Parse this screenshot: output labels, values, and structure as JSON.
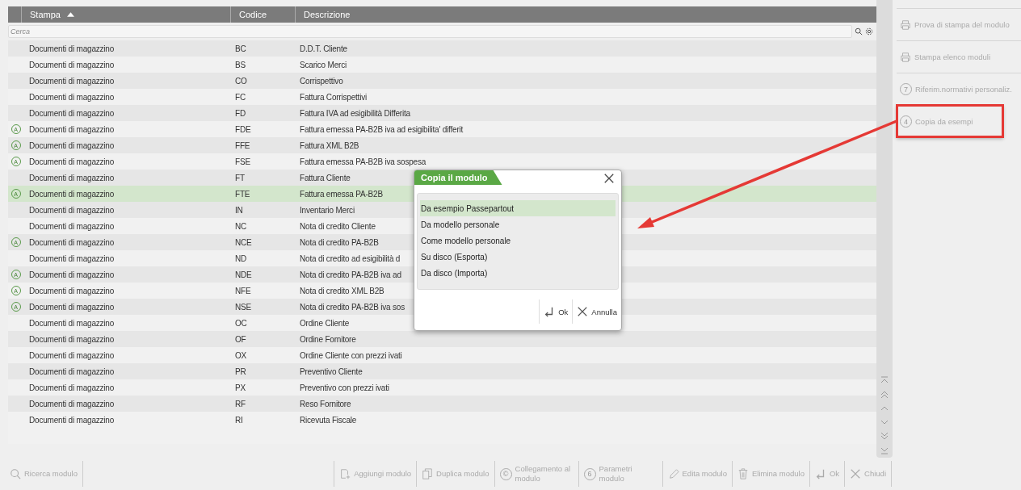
{
  "table": {
    "columns": [
      {
        "label": "Stampa",
        "sorted": true
      },
      {
        "label": "Codice",
        "sorted": false
      },
      {
        "label": "Descrizione",
        "sorted": false
      }
    ],
    "search": {
      "placeholder": "Cerca"
    },
    "rows": [
      {
        "stampa": "Documenti di magazzino",
        "codice": "BC",
        "descrizione": "D.D.T. Cliente",
        "selected": false
      },
      {
        "stampa": "Documenti di magazzino",
        "codice": "BS",
        "descrizione": "Scarico Merci",
        "selected": false
      },
      {
        "stampa": "Documenti di magazzino",
        "codice": "CO",
        "descrizione": "Corrispettivo",
        "selected": false
      },
      {
        "stampa": "Documenti di magazzino",
        "codice": "FC",
        "descrizione": "Fattura Corrispettivi",
        "selected": false
      },
      {
        "stampa": "Documenti di magazzino",
        "codice": "FD",
        "descrizione": "Fattura IVA ad esigibilità Differita",
        "selected": false
      },
      {
        "badge": "A",
        "stampa": "Documenti di magazzino",
        "codice": "FDE",
        "descrizione": "Fattura emessa PA-B2B iva ad esigibilita' differit",
        "selected": false
      },
      {
        "badge": "A",
        "stampa": "Documenti di magazzino",
        "codice": "FFE",
        "descrizione": "Fattura XML B2B",
        "selected": false
      },
      {
        "badge": "A",
        "stampa": "Documenti di magazzino",
        "codice": "FSE",
        "descrizione": "Fattura emessa PA-B2B iva sospesa",
        "selected": false
      },
      {
        "stampa": "Documenti di magazzino",
        "codice": "FT",
        "descrizione": "Fattura Cliente",
        "selected": false
      },
      {
        "badge": "A",
        "stampa": "Documenti di magazzino",
        "codice": "FTE",
        "descrizione": "Fattura emessa PA-B2B",
        "selected": true
      },
      {
        "stampa": "Documenti di magazzino",
        "codice": "IN",
        "descrizione": "Inventario Merci",
        "selected": false
      },
      {
        "stampa": "Documenti di magazzino",
        "codice": "NC",
        "descrizione": "Nota di credito Cliente",
        "selected": false
      },
      {
        "badge": "A",
        "stampa": "Documenti di magazzino",
        "codice": "NCE",
        "descrizione": "Nota di credito PA-B2B",
        "selected": false
      },
      {
        "stampa": "Documenti di magazzino",
        "codice": "ND",
        "descrizione": "Nota di credito ad esigibilità d",
        "selected": false
      },
      {
        "badge": "A",
        "stampa": "Documenti di magazzino",
        "codice": "NDE",
        "descrizione": "Nota di credito PA-B2B iva ad",
        "selected": false
      },
      {
        "badge": "A",
        "stampa": "Documenti di magazzino",
        "codice": "NFE",
        "descrizione": "Nota di credito XML B2B",
        "selected": false
      },
      {
        "badge": "A",
        "stampa": "Documenti di magazzino",
        "codice": "NSE",
        "descrizione": "Nota di credito PA-B2B iva sos",
        "selected": false
      },
      {
        "stampa": "Documenti di magazzino",
        "codice": "OC",
        "descrizione": "Ordine Cliente",
        "selected": false
      },
      {
        "stampa": "Documenti di magazzino",
        "codice": "OF",
        "descrizione": "Ordine Fornitore",
        "selected": false
      },
      {
        "stampa": "Documenti di magazzino",
        "codice": "OX",
        "descrizione": "Ordine Cliente con prezzi ivati",
        "selected": false
      },
      {
        "stampa": "Documenti di magazzino",
        "codice": "PR",
        "descrizione": "Preventivo Cliente",
        "selected": false
      },
      {
        "stampa": "Documenti di magazzino",
        "codice": "PX",
        "descrizione": "Preventivo con prezzi ivati",
        "selected": false
      },
      {
        "stampa": "Documenti di magazzino",
        "codice": "RF",
        "descrizione": "Reso Fornitore",
        "selected": false
      },
      {
        "stampa": "Documenti di magazzino",
        "codice": "RI",
        "descrizione": "Ricevuta Fiscale",
        "selected": false
      }
    ]
  },
  "side_panel": {
    "items": [
      {
        "kind": "printer",
        "label": "Prova di stampa del modulo",
        "highlighted": false
      },
      {
        "kind": "printer",
        "label": "Stampa elenco moduli",
        "highlighted": false
      },
      {
        "kind": "circled",
        "badge": "7",
        "label": "Riferim.normativi personaliz.",
        "highlighted": false
      },
      {
        "kind": "circled",
        "badge": "4",
        "label": "Copia da esempi",
        "highlighted": true
      }
    ]
  },
  "dialog": {
    "title": "Copia il modulo",
    "options": [
      {
        "label": "Da esempio Passepartout",
        "selected": true
      },
      {
        "label": "Da modello personale",
        "selected": false
      },
      {
        "label": "Come modello personale",
        "selected": false
      },
      {
        "label": "Su disco (Esporta)",
        "selected": false
      },
      {
        "label": "Da disco (Importa)",
        "selected": false
      }
    ],
    "buttons": [
      {
        "kind": "enter",
        "label": "Ok"
      },
      {
        "kind": "close",
        "label": "Annulla"
      }
    ]
  },
  "toolbar_left": [
    {
      "kind": "search",
      "label": "Ricerca modulo"
    }
  ],
  "toolbar": [
    {
      "kind": "add",
      "label": "Aggiungi modulo"
    },
    {
      "kind": "copy",
      "label": "Duplica modulo"
    },
    {
      "kind": "circled",
      "badge": "©",
      "label": "Collegamento al modulo"
    },
    {
      "kind": "circled",
      "badge": "6",
      "label": "Parametri modulo"
    },
    {
      "kind": "edit",
      "label": "Edita modulo"
    },
    {
      "kind": "trash",
      "label": "Elimina modulo"
    },
    {
      "kind": "enter",
      "label": "Ok"
    },
    {
      "kind": "close",
      "label": "Chiudi"
    }
  ]
}
